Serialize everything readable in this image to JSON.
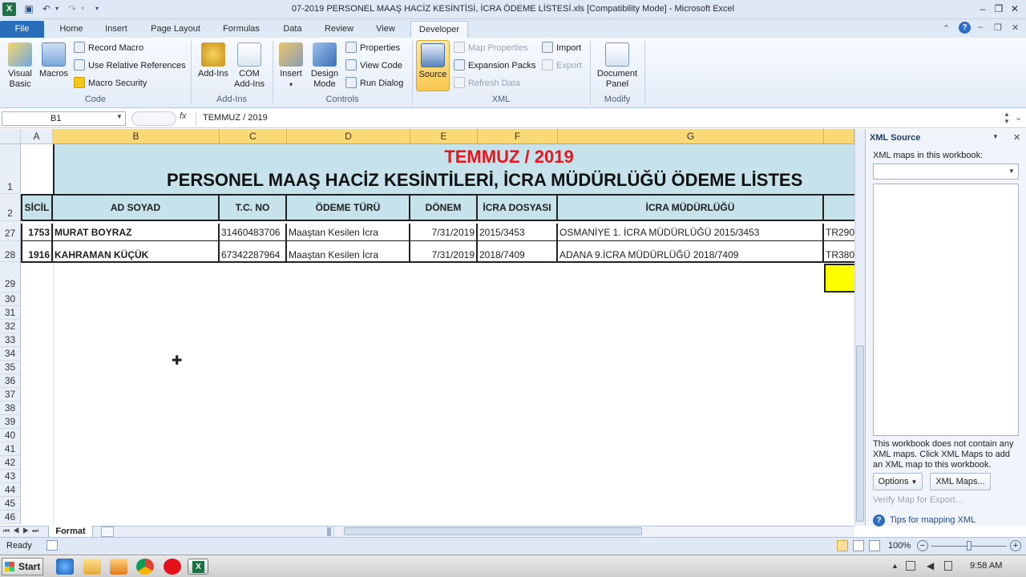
{
  "window": {
    "title": "07-2019 PERSONEL MAAŞ HACİZ KESİNTİSİ, İCRA ÖDEME LİSTESİ.xls  [Compatibility Mode]  -  Microsoft Excel",
    "app_icon": "X"
  },
  "tabs": [
    "File",
    "Home",
    "Insert",
    "Page Layout",
    "Formulas",
    "Data",
    "Review",
    "View",
    "Developer"
  ],
  "active_tab": "Developer",
  "ribbon": {
    "code": {
      "visual_basic": "Visual Basic",
      "macros": "Macros",
      "record_macro": "Record Macro",
      "relative_refs": "Use Relative References",
      "macro_security": "Macro Security",
      "label": "Code"
    },
    "addins": {
      "addins": "Add-Ins",
      "com_addins": "COM Add-Ins",
      "label": "Add-Ins"
    },
    "controls": {
      "insert": "Insert",
      "design_mode": "Design Mode",
      "properties": "Properties",
      "view_code": "View Code",
      "run_dialog": "Run Dialog",
      "label": "Controls"
    },
    "xml": {
      "source": "Source",
      "map_properties": "Map Properties",
      "expansion_packs": "Expansion Packs",
      "refresh_data": "Refresh Data",
      "import": "Import",
      "export": "Export",
      "label": "XML"
    },
    "modify": {
      "document_panel": "Document Panel",
      "label": "Modify"
    }
  },
  "formula_bar": {
    "name_box": "B1",
    "fx": "fx",
    "content": "TEMMUZ / 2019"
  },
  "columns": [
    "A",
    "B",
    "C",
    "D",
    "E",
    "F",
    "G"
  ],
  "sheet": {
    "title1": "TEMMUZ / 2019",
    "title2": "PERSONEL MAAŞ HACİZ KESİNTİLERİ, İCRA MÜDÜRLÜĞÜ ÖDEME LİSTES",
    "headers": [
      "SİCİL",
      "AD SOYAD",
      "T.C. NO",
      "ÖDEME TÜRÜ",
      "DÖNEM",
      "İCRA DOSYASI",
      "İCRA MÜDÜRLÜĞÜ"
    ],
    "rows": [
      {
        "row": "27",
        "sicil": "1753",
        "name": "MURAT BOYRAZ",
        "tc": "31460483706",
        "type": "Maaştan Kesilen İcra",
        "period": "7/31/2019",
        "file": "2015/3453",
        "office": "OSMANİYE 1. İCRA MÜDÜRLÜĞÜ 2015/3453",
        "iban": "TR290"
      },
      {
        "row": "28",
        "sicil": "1916",
        "name": "KAHRAMAN KÜÇÜK",
        "tc": "67342287964",
        "type": "Maaştan Kesilen İcra",
        "period": "7/31/2019",
        "file": "2018/7409",
        "office": "ADANA 9.İCRA MÜDÜRLÜĞÜ 2018/7409",
        "iban": "TR380"
      }
    ],
    "row_numbers": [
      "1",
      "2",
      "29",
      "30",
      "31",
      "32",
      "33",
      "34",
      "35",
      "36",
      "37",
      "38",
      "39",
      "40",
      "41",
      "42",
      "43",
      "44",
      "45",
      "46"
    ]
  },
  "xml_pane": {
    "title": "XML Source",
    "maps_label": "XML maps in this workbook:",
    "message": "This workbook does not contain any XML maps. Click XML Maps to add an XML map to this workbook.",
    "options": "Options",
    "xml_maps": "XML Maps...",
    "verify": "Verify Map for Export...",
    "tips": "Tips for mapping XML"
  },
  "sheet_tab": "Format",
  "status": {
    "ready": "Ready",
    "zoom": "100%"
  },
  "taskbar": {
    "start": "Start",
    "clock": "9:58 AM"
  },
  "colors": {
    "title_red": "#e8161c",
    "header_fill": "#c6e2ea",
    "yellow": "#ffff00",
    "file_tab": "#2a6eb9"
  }
}
